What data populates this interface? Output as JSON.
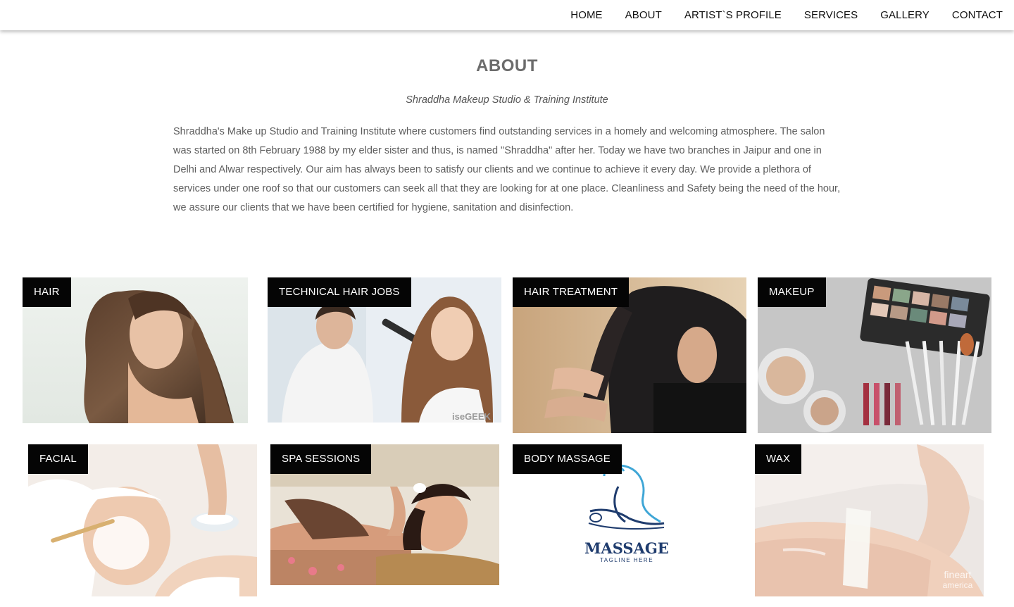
{
  "nav": {
    "items": [
      "HOME",
      "ABOUT",
      "ARTIST`S PROFILE",
      "SERVICES",
      "GALLERY",
      "CONTACT"
    ]
  },
  "about": {
    "title": "ABOUT",
    "subtitle": "Shraddha Makeup Studio & Training Institute",
    "body": "Shraddha's Make up Studio and Training Institute where customers find outstanding services in a homely and welcoming atmosphere. The salon was started on 8th February 1988 by my elder sister and thus, is named \"Shraddha\" after her. Today we have two branches in Jaipur and one in Delhi and Alwar respectively. Our aim has always been to satisfy our clients and we continue to achieve it every day. We provide a plethora of services under one roof so that our customers can seek all that they are looking for at one place. Cleanliness and Safety being the need of the hour, we assure our clients that we have been certified for hygiene, sanitation and disinfection."
  },
  "services": [
    {
      "label": "HAIR"
    },
    {
      "label": "TECHNICAL HAIR JOBS",
      "watermark": "iseGEEK"
    },
    {
      "label": "HAIR TREATMENT"
    },
    {
      "label": "MAKEUP"
    },
    {
      "label": "FACIAL"
    },
    {
      "label": "SPA SESSIONS"
    },
    {
      "label": "BODY MASSAGE",
      "logo_text": "MASSAGE",
      "logo_tagline": "TAGLINE HERE"
    },
    {
      "label": "WAX",
      "watermark_1": "fineart",
      "watermark_2": "america"
    }
  ]
}
